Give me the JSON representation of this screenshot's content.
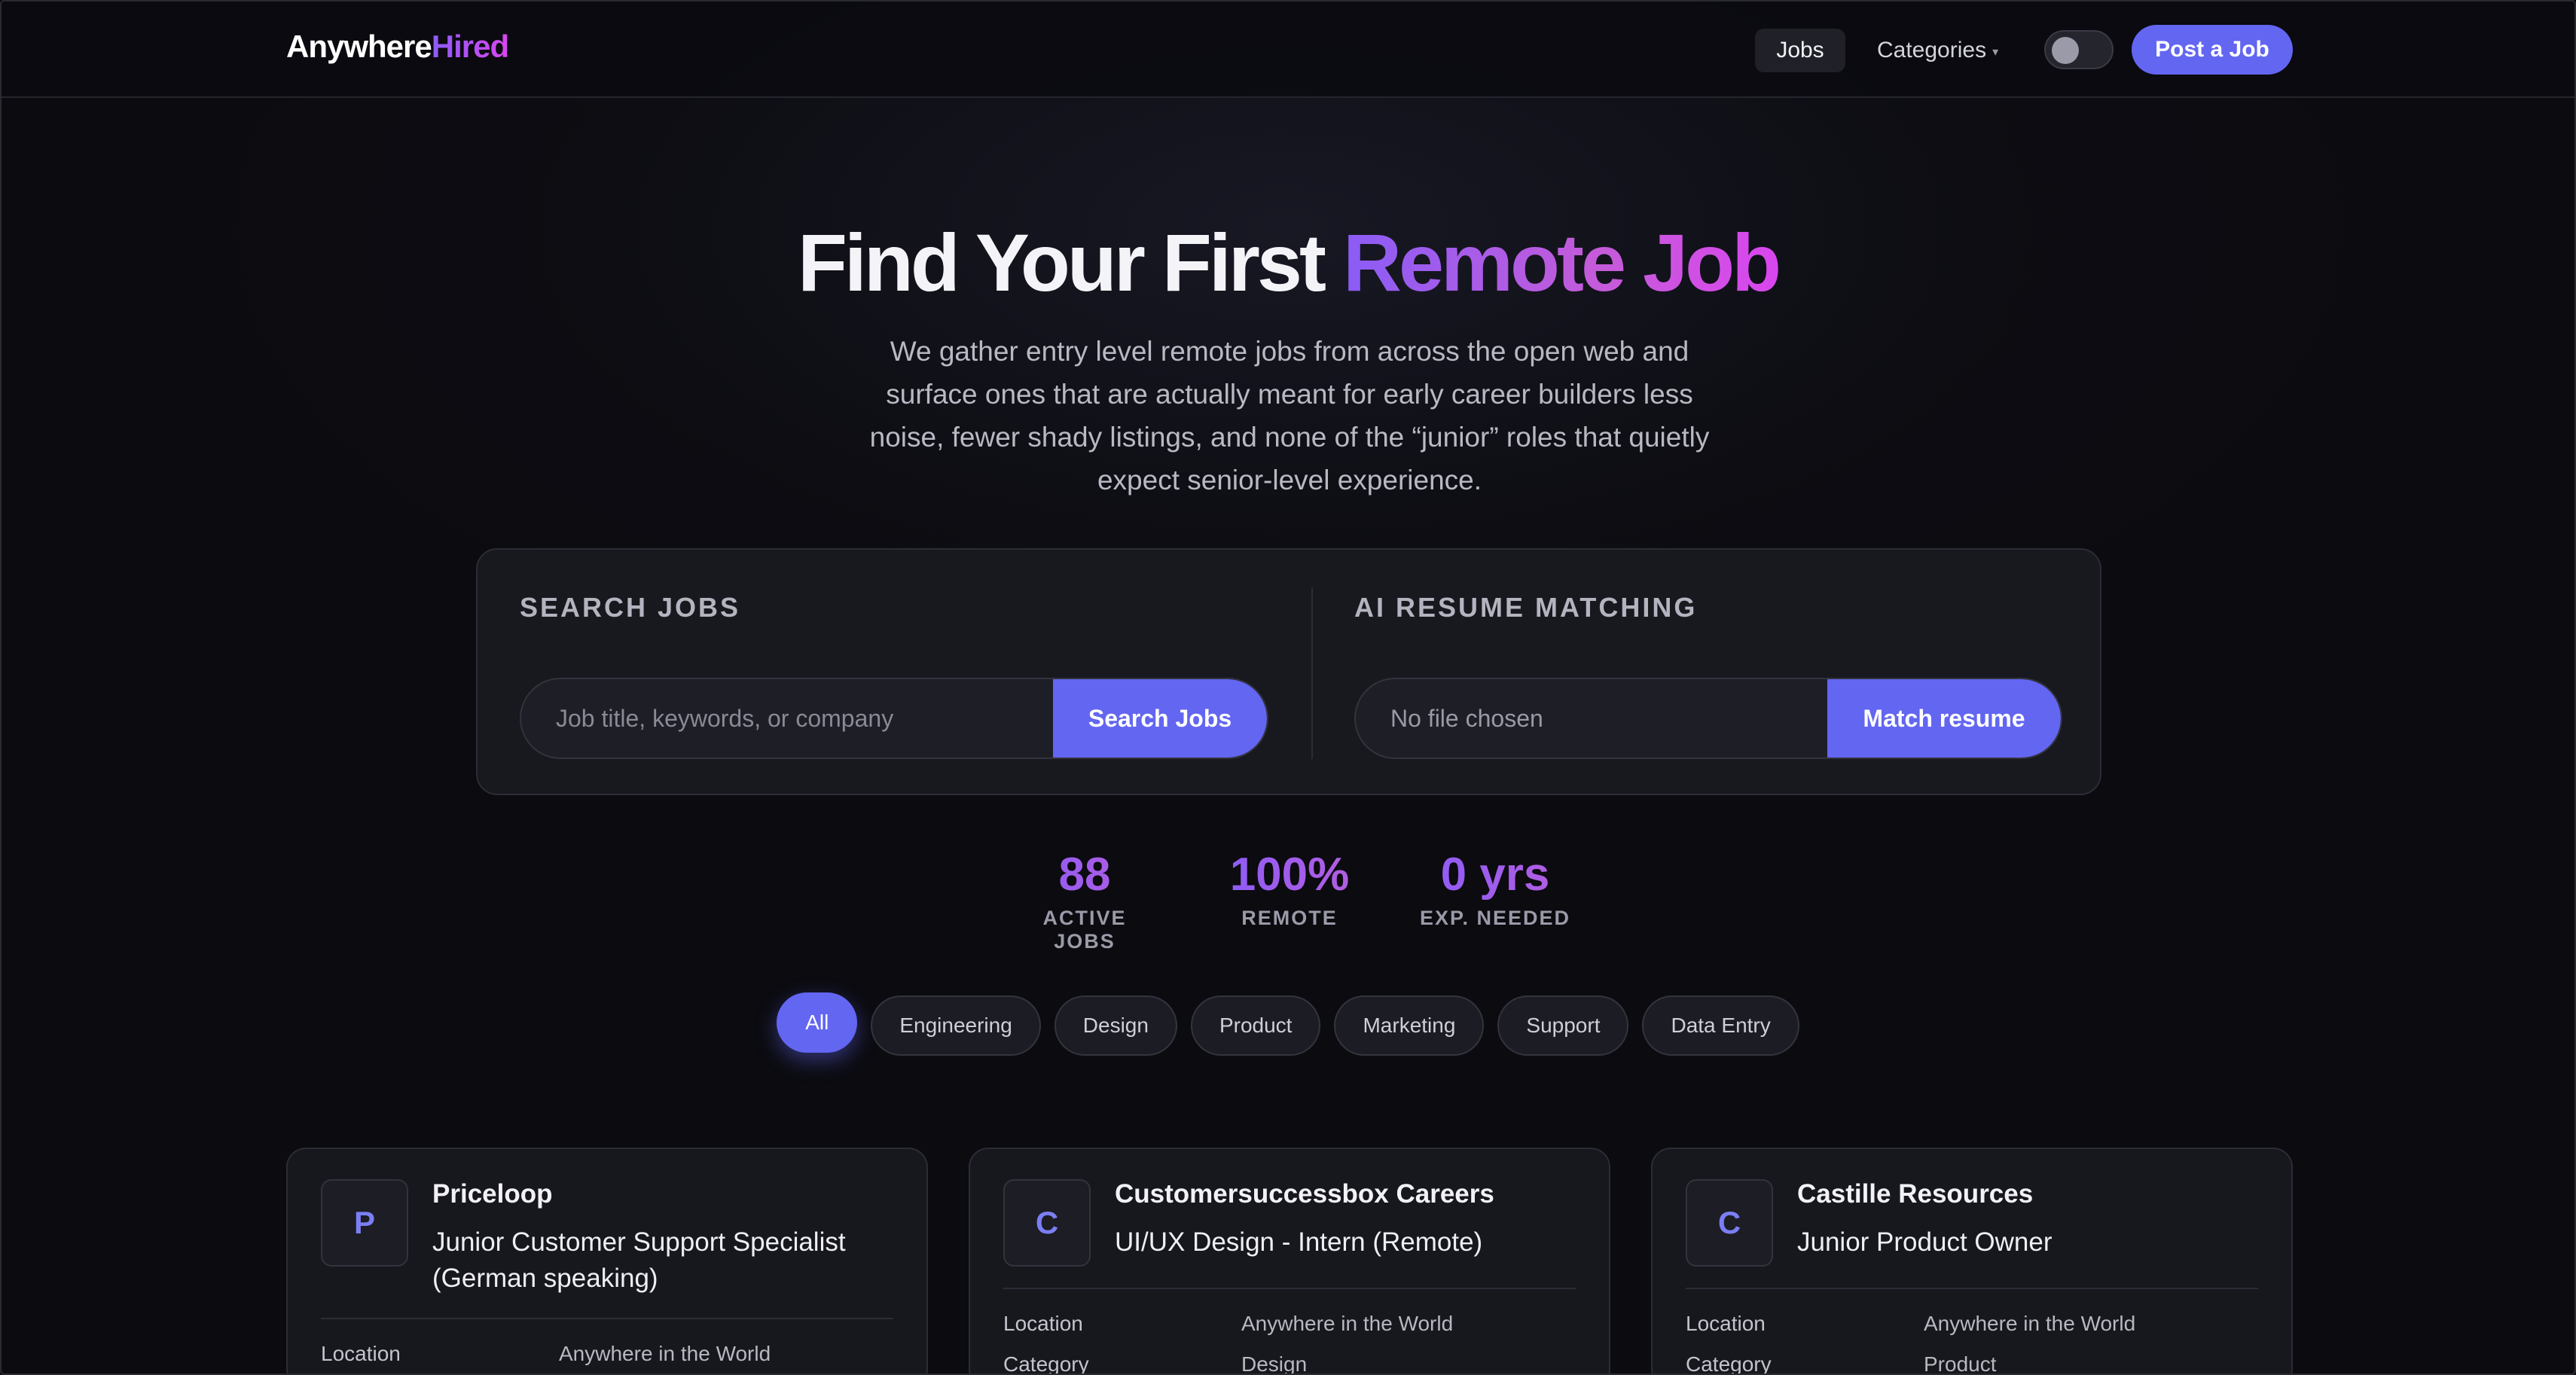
{
  "nav": {
    "logo_main": "Anywhere",
    "logo_accent": "Hired",
    "jobs_label": "Jobs",
    "categories_label": "Categories",
    "caret": "▾",
    "post_label": "Post a Job"
  },
  "hero": {
    "title_main": "Find Your First ",
    "title_accent": "Remote Job",
    "subtitle": "We gather entry level remote jobs from across the open web and surface ones that are actually meant for early career builders less noise, fewer shady listings, and none of the “junior” roles that quietly expect senior-level experience."
  },
  "search": {
    "heading": "SEARCH JOBS",
    "placeholder": "Job title, keywords, or company",
    "button": "Search Jobs"
  },
  "ai": {
    "heading": "AI RESUME MATCHING",
    "file_status": "No file chosen",
    "button": "Match resume"
  },
  "stats": [
    {
      "value": "88",
      "label": "ACTIVE JOBS"
    },
    {
      "value": "100%",
      "label": "REMOTE"
    },
    {
      "value": "0 yrs",
      "label": "EXP. NEEDED"
    }
  ],
  "filters": {
    "items": [
      "All",
      "Engineering",
      "Design",
      "Product",
      "Marketing",
      "Support",
      "Data Entry"
    ],
    "active": "All"
  },
  "jobs": [
    {
      "initial": "P",
      "company": "Priceloop",
      "title": "Junior Customer Support Specialist (German speaking)",
      "location_label": "Location",
      "location": "Anywhere in the World"
    },
    {
      "initial": "C",
      "company": "Customersuccessbox Careers",
      "title": "UI/UX Design - Intern (Remote)",
      "location_label": "Location",
      "location": "Anywhere in the World",
      "category_label": "Category",
      "category": "Design"
    },
    {
      "initial": "C",
      "company": "Castille Resources",
      "title": "Junior Product Owner",
      "location_label": "Location",
      "location": "Anywhere in the World",
      "category_label": "Category",
      "category": "Product"
    }
  ],
  "colors": {
    "accent": "#6366f1",
    "gradient_start": "#8b5cf6",
    "gradient_end": "#d946ef",
    "background": "#0b0b10"
  }
}
